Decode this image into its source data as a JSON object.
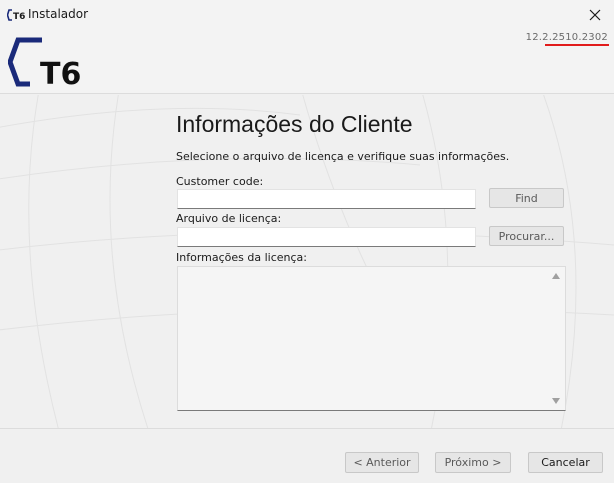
{
  "window": {
    "title": "Instalador",
    "icon": "t6-small-logo-icon"
  },
  "header": {
    "logo_text": "T6",
    "version": "12.2.2510.2302",
    "brand_color": "#1a2a7a",
    "version_underline_color": "#e11b1b"
  },
  "main": {
    "title": "Informações do Cliente",
    "subtitle": "Selecione o arquivo de licença e verifique suas informações.",
    "customer_code": {
      "label": "Customer code:",
      "value": "",
      "button_label": "Find"
    },
    "license_file": {
      "label": "Arquivo de licença:",
      "value": "",
      "button_label": "Procurar..."
    },
    "license_info": {
      "label": "Informações da licença:",
      "value": ""
    }
  },
  "footer": {
    "back_label": "< Anterior",
    "next_label": "Próximo >",
    "cancel_label": "Cancelar"
  }
}
